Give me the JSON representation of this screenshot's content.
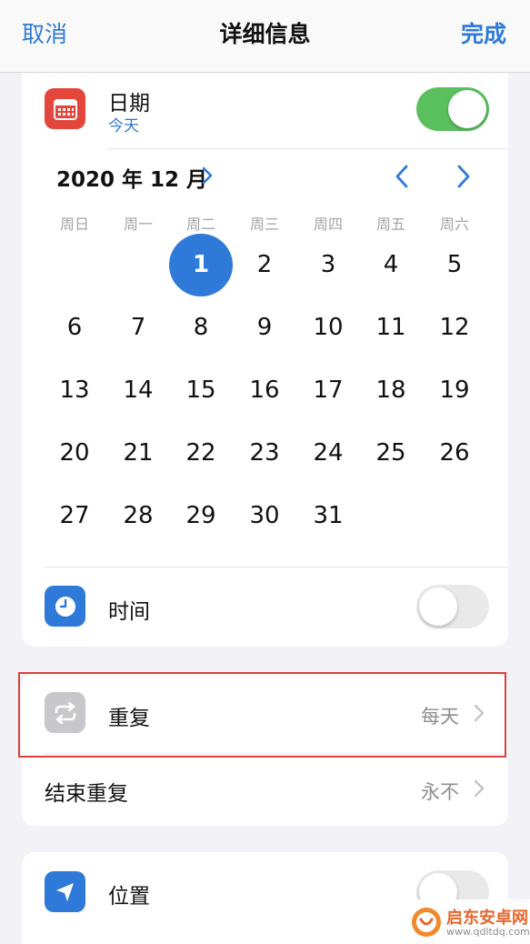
{
  "nav": {
    "cancel": "取消",
    "title": "详细信息",
    "done": "完成"
  },
  "date_row": {
    "title": "日期",
    "subtitle": "今天",
    "toggle_on": true,
    "icon": "calendar-icon",
    "icon_color": "#e4463c"
  },
  "calendar": {
    "month_label": "2020 年 12 月",
    "weekdays": [
      "周日",
      "周一",
      "周二",
      "周三",
      "周四",
      "周五",
      "周六"
    ],
    "selected_day": "1",
    "weeks": [
      [
        "",
        "",
        "1",
        "2",
        "3",
        "4",
        "5"
      ],
      [
        "6",
        "7",
        "8",
        "9",
        "10",
        "11",
        "12"
      ],
      [
        "13",
        "14",
        "15",
        "16",
        "17",
        "18",
        "19"
      ],
      [
        "20",
        "21",
        "22",
        "23",
        "24",
        "25",
        "26"
      ],
      [
        "27",
        "28",
        "29",
        "30",
        "31",
        "",
        ""
      ]
    ]
  },
  "time_row": {
    "title": "时间",
    "toggle_on": false,
    "icon": "clock-icon",
    "icon_color": "#2f7ad8"
  },
  "repeat_row": {
    "title": "重复",
    "value": "每天",
    "icon": "repeat-icon",
    "icon_color": "#c7c7cc"
  },
  "end_repeat_row": {
    "title": "结束重复",
    "value": "永不"
  },
  "location_row": {
    "title": "位置",
    "toggle_on": false,
    "icon": "location-arrow-icon",
    "icon_color": "#2f7ad8"
  },
  "watermark": {
    "name": "启东安卓网",
    "url": "www.qdltdq.com"
  },
  "colors": {
    "accent": "#2f7ad8",
    "toggle_green": "#5ac05e",
    "highlight_border": "#d9423c"
  }
}
